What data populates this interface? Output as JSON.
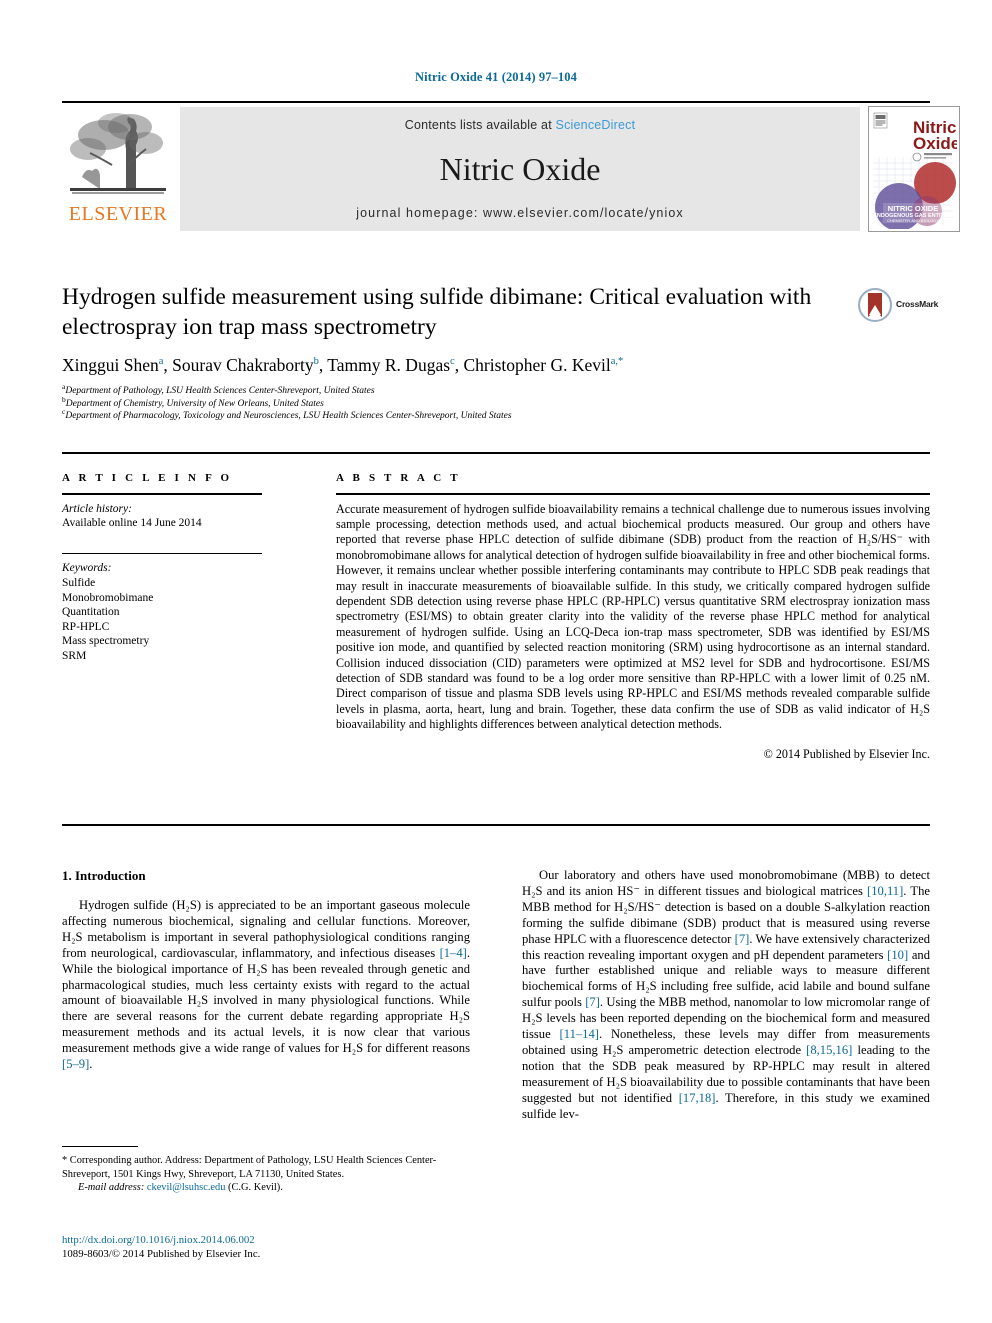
{
  "running_head": "Nitric Oxide 41 (2014) 97–104",
  "masthead": {
    "contents_prefix": "Contents lists available at ",
    "sciencedirect": "ScienceDirect",
    "journal_title": "Nitric Oxide",
    "homepage": "journal homepage: www.elsevier.com/locate/yniox",
    "publisher_logo_text": "ELSEVIER",
    "cover_title_line1": "Nitric",
    "cover_title_line2": "Oxide",
    "cover_strip_line1": "NITRIC OXIDE",
    "cover_strip_line2": "ENDOGENOUS GAS ENTITIES",
    "cover_strip_line3": "CHEMISTRY AND BIOLOGY"
  },
  "crossmark": {
    "label": "CrossMark"
  },
  "article": {
    "title": "Hydrogen sulfide measurement using sulfide dibimane: Critical evaluation with electrospray ion trap mass spectrometry",
    "authors": [
      {
        "name": "Xinggui Shen",
        "marks": "a"
      },
      {
        "name": "Sourav Chakraborty",
        "marks": "b"
      },
      {
        "name": "Tammy R. Dugas",
        "marks": "c"
      },
      {
        "name": "Christopher G. Kevil",
        "marks": "a,*"
      }
    ],
    "affiliations": [
      {
        "mark": "a",
        "text": "Department of Pathology, LSU Health Sciences Center-Shreveport, United States"
      },
      {
        "mark": "b",
        "text": "Department of Chemistry, University of New Orleans, United States"
      },
      {
        "mark": "c",
        "text": "Department of Pharmacology, Toxicology and Neurosciences, LSU Health Sciences Center-Shreveport, United States"
      }
    ]
  },
  "article_info": {
    "heading": "A R T I C L E    I N F O",
    "history_label": "Article history:",
    "history_value": "Available online 14 June 2014",
    "keywords_label": "Keywords:",
    "keywords": [
      "Sulfide",
      "Monobromobimane",
      "Quantitation",
      "RP-HPLC",
      "Mass spectrometry",
      "SRM"
    ]
  },
  "abstract": {
    "heading": "A B S T R A C T",
    "text": "Accurate measurement of hydrogen sulfide bioavailability remains a technical challenge due to numerous issues involving sample processing, detection methods used, and actual biochemical products measured. Our group and others have reported that reverse phase HPLC detection of sulfide dibimane (SDB) product from the reaction of H₂S/HS⁻ with monobromobimane allows for analytical detection of hydrogen sulfide bioavailability in free and other biochemical forms. However, it remains unclear whether possible interfering contaminants may contribute to HPLC SDB peak readings that may result in inaccurate measurements of bioavailable sulfide. In this study, we critically compared hydrogen sulfide dependent SDB detection using reverse phase HPLC (RP-HPLC) versus quantitative SRM electrospray ionization mass spectrometry (ESI/MS) to obtain greater clarity into the validity of the reverse phase HPLC method for analytical measurement of hydrogen sulfide. Using an LCQ-Deca ion-trap mass spectrometer, SDB was identified by ESI/MS positive ion mode, and quantified by selected reaction monitoring (SRM) using hydrocortisone as an internal standard. Collision induced dissociation (CID) parameters were optimized at MS2 level for SDB and hydrocortisone. ESI/MS detection of SDB standard was found to be a log order more sensitive than RP-HPLC with a lower limit of 0.25 nM. Direct comparison of tissue and plasma SDB levels using RP-HPLC and ESI/MS methods revealed comparable sulfide levels in plasma, aorta, heart, lung and brain. Together, these data confirm the use of SDB as valid indicator of H₂S bioavailability and highlights differences between analytical detection methods.",
    "copyright": "© 2014 Published by Elsevier Inc."
  },
  "introduction": {
    "heading": "1. Introduction",
    "left_para_1_a": "Hydrogen sulfide (H₂S) is appreciated to be an important gaseous molecule affecting numerous biochemical, signaling and cellular functions. Moreover, H₂S metabolism is important in several pathophysiological conditions ranging from neurological, cardiovascular, inflammatory, and infectious diseases ",
    "left_ref_1": "[1–4]",
    "left_para_1_b": ". While the biological importance of H₂S has been revealed through genetic and pharmacological studies, much less certainty exists with regard to the actual amount of bioavailable H₂S involved in many physiological functions. While there are several reasons for the current debate regarding appropriate H₂S measurement methods and its actual levels, it is now clear that various measurement methods give a wide range of values for H₂S for different reasons ",
    "left_ref_2": "[5–9]",
    "left_para_1_c": ".",
    "right_a": "Our laboratory and others have used monobromobimane (MBB) to detect H₂S and its anion HS⁻ in different tissues and biological matrices ",
    "right_ref_1": "[10,11]",
    "right_b": ". The MBB method for H₂S/HS⁻ detection is based on a double S-alkylation reaction forming the sulfide dibimane (SDB) product that is measured using reverse phase HPLC with a fluorescence detector ",
    "right_ref_2": "[7]",
    "right_c": ". We have extensively characterized this reaction revealing important oxygen and pH dependent parameters ",
    "right_ref_3": "[10]",
    "right_d": " and have further established unique and reliable ways to measure different biochemical forms of H₂S including free sulfide, acid labile and bound sulfane sulfur pools ",
    "right_ref_4": "[7]",
    "right_e": ". Using the MBB method, nanomolar to low micromolar range of H₂S levels has been reported depending on the biochemical form and measured tissue ",
    "right_ref_5": "[11–14]",
    "right_f": ". Nonetheless, these levels may differ from measurements obtained using H₂S amperometric detection electrode ",
    "right_ref_6": "[8,15,16]",
    "right_g": " leading to the notion that the SDB peak measured by RP-HPLC may result in altered measurement of H₂S bioavailability due to possible contaminants that have been suggested but not identified ",
    "right_ref_7": "[17,18]",
    "right_h": ". Therefore, in this study we examined sulfide lev-"
  },
  "footnote": {
    "star": "*",
    "corresponding": " Corresponding author. Address: Department of Pathology, LSU Health Sciences Center-Shreveport, 1501 Kings Hwy, Shreveport, LA 71130, United States.",
    "email_label": "E-mail address:",
    "email": "ckevil@lsuhsc.edu",
    "email_suffix": " (C.G. Kevil)."
  },
  "publication": {
    "doi": "http://dx.doi.org/10.1016/j.niox.2014.06.002",
    "issn_line": "1089-8603/© 2014 Published by Elsevier Inc."
  },
  "colors": {
    "link": "#0b6a99",
    "sciencedirect": "#3a9ad9",
    "elsevier_orange": "#e87722",
    "band_gray": "#e6e6e6"
  }
}
